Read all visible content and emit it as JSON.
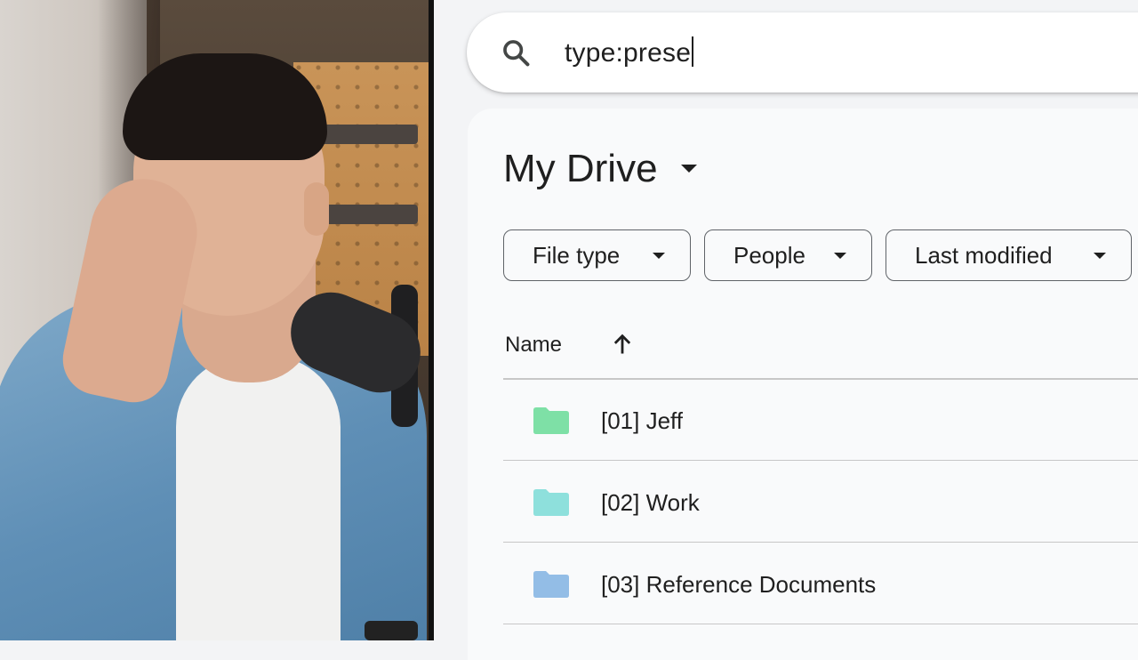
{
  "search": {
    "query": "type:prese",
    "icon": "search-icon"
  },
  "drive": {
    "title": "My Drive",
    "filters": [
      {
        "label": "File type"
      },
      {
        "label": "People"
      },
      {
        "label": "Last modified"
      }
    ],
    "column_name": "Name",
    "sort_icon": "arrow-up-icon",
    "files": [
      {
        "name": "[01] Jeff",
        "color": "#7ee0a6"
      },
      {
        "name": "[02] Work",
        "color": "#8ee0dc"
      },
      {
        "name": "[03] Reference Documents",
        "color": "#93bde6"
      }
    ]
  }
}
